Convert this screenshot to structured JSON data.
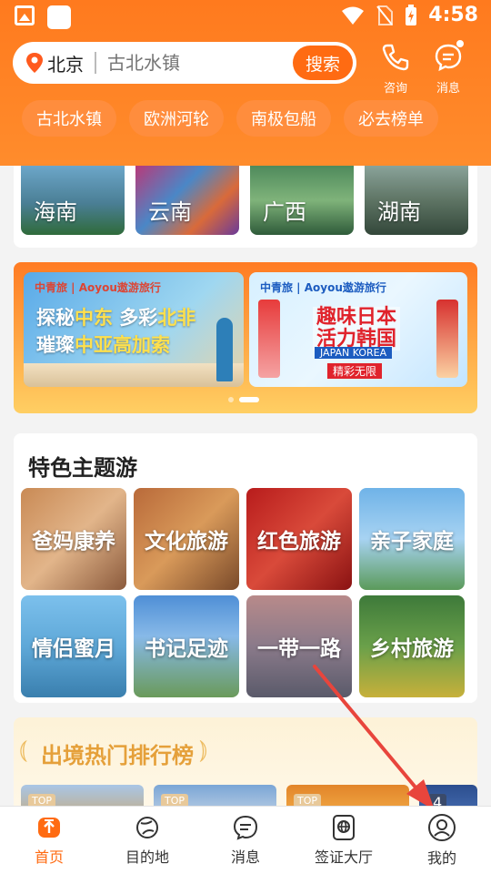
{
  "status_bar": {
    "time": "4:58"
  },
  "search": {
    "city": "北京",
    "placeholder": "古北水镇",
    "button": "搜索"
  },
  "header_actions": [
    {
      "icon": "phone-icon",
      "label": "咨询"
    },
    {
      "icon": "message-icon",
      "label": "消息"
    }
  ],
  "hot_tags": [
    "古北水镇",
    "欧洲河轮",
    "南极包船",
    "必去榜单"
  ],
  "destinations": [
    "海南",
    "云南",
    "广西",
    "湖南"
  ],
  "banners": [
    {
      "logo": "中青旅 | Aoyou遨游旅行",
      "line1a": "探秘",
      "line1b": "中东",
      "line1c": " 多彩",
      "line1d": "北非",
      "line2a": "璀璨",
      "line2b": "中亚高加索"
    },
    {
      "logo": "中青旅 | Aoyou遨游旅行",
      "title1": "趣味日本",
      "title2": "活力韩国",
      "badge": "JAPAN KOREA",
      "sub": "精彩无限"
    }
  ],
  "themes": {
    "title": "特色主题游",
    "items": [
      "爸妈康养",
      "文化旅游",
      "红色旅游",
      "亲子家庭",
      "情侣蜜月",
      "书记足迹",
      "一带一路",
      "乡村旅游"
    ]
  },
  "ranking": {
    "title": "出境热门排行榜",
    "badge": "TOP",
    "fourth": "4"
  },
  "tabbar": [
    {
      "icon": "home-icon",
      "label": "首页",
      "active": true
    },
    {
      "icon": "planet-icon",
      "label": "目的地"
    },
    {
      "icon": "chat-icon",
      "label": "消息"
    },
    {
      "icon": "visa-icon",
      "label": "签证大厅"
    },
    {
      "icon": "profile-icon",
      "label": "我的"
    }
  ],
  "colors": {
    "accent": "#ff6b12",
    "header": "#ff7a1e",
    "annotation": "#e8453c"
  }
}
